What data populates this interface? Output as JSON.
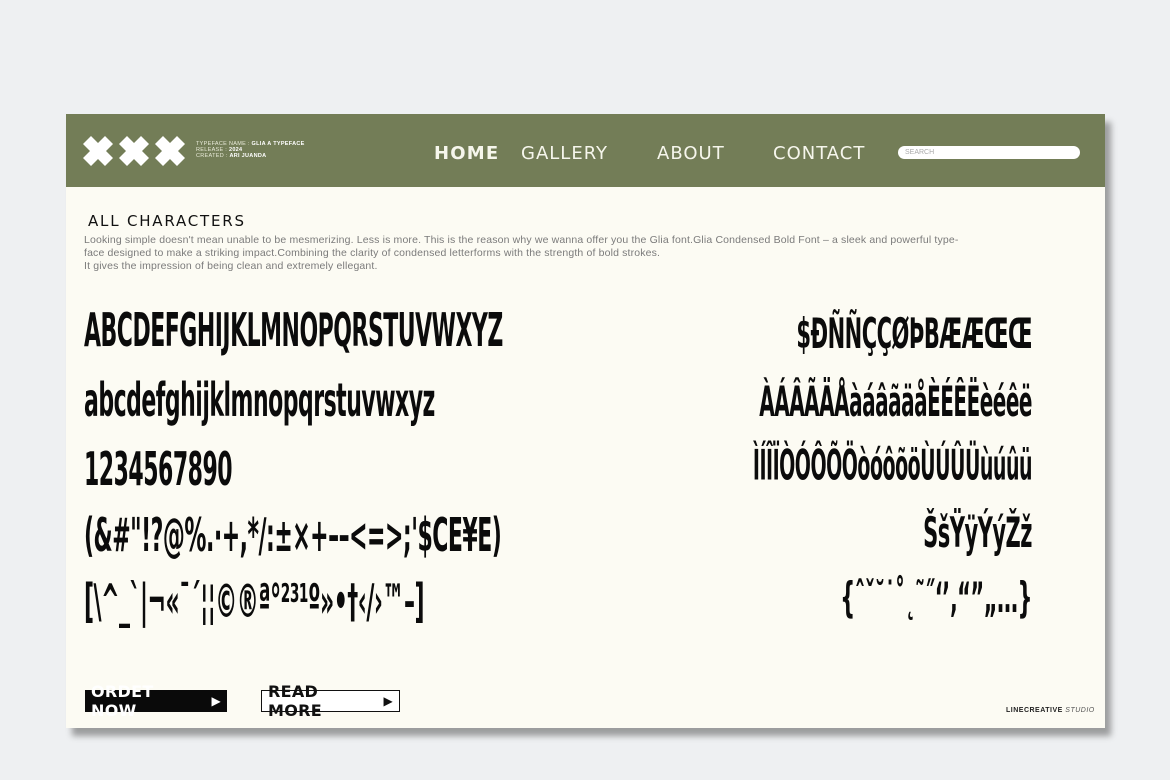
{
  "header": {
    "meta_lines": [
      {
        "label": "TYPEFACE NAME : ",
        "value": "GLIA A TYPEFACE"
      },
      {
        "label": "RELEASE : ",
        "value": "2024"
      },
      {
        "label": "CREATED : ",
        "value": "ARI JUANDA"
      }
    ],
    "nav": [
      "HOME",
      "GALLERY",
      "ABOUT",
      "CONTACT"
    ],
    "active_nav": "HOME",
    "search_placeholder": "SEARCH"
  },
  "main": {
    "title": "ALL CHARACTERS",
    "description": [
      "Looking simple doesn't mean unable to be mesmerizing. Less is more. This is the reason why we wanna offer you the Glia font.Glia Condensed Bold Font – a sleek and powerful type-",
      "face designed to make a striking impact.Combining the clarity of condensed letterforms with the strength of bold strokes.",
      "It gives the impression of being clean and extremely ellegant."
    ],
    "glyph_rows_left": [
      "ABCDEFGHIJKLMNOPQRSTUVWXYZ",
      "abcdefghijklmnopqrstuvwxyz",
      "1234567890",
      "(&#\"!?@%.·+,*/:±×+––<=>;'$CE¥E)",
      "[\\^_`|¬«¯´¦¦©®ª°²³¹º»•†‹/›™–]"
    ],
    "glyph_rows_right": [
      "$ÐÑÑÇÇØÞBÆÆŒŒ",
      "ÀÁÂÃÄÅàáâãäåÈÉÊËèéêë",
      "ÌÍÎÏÒÓÔÕÖòóôõöÙÚÛÜùúûü",
      "ŠšŸÿÝýŽž",
      "{ˆˇ˘˙˚˛˜˝‘’‚“”„…}"
    ]
  },
  "footer": {
    "order_label": "ORDET NOW",
    "read_label": "READ MORE",
    "studio_name": "LINECREATIVE",
    "studio_suffix": "STUDIO"
  },
  "colors": {
    "header_bg": "#737d57",
    "page_bg": "#fcfbf3",
    "ink": "#0b0b0b"
  }
}
